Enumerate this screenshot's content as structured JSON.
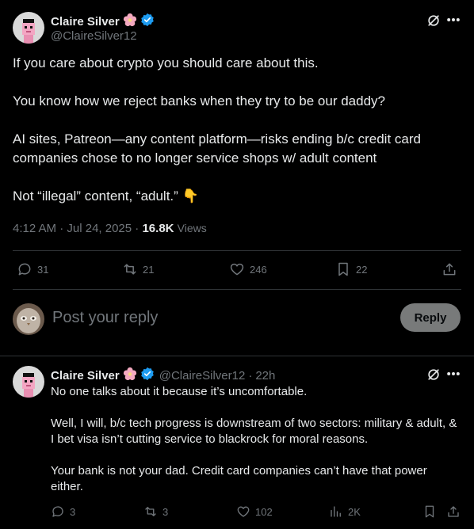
{
  "main_tweet": {
    "author_name": "Claire Silver",
    "author_handle": "@ClaireSilver12",
    "paragraphs": [
      "If you care about crypto you should care about this.",
      "You know how we reject banks when they try to be our daddy?",
      "AI sites, Patreon—any content platform—risks ending b/c credit card companies chose to no longer service shops w/ adult content",
      "Not “illegal” content, “adult.” 👇"
    ],
    "time": "4:12 AM",
    "date": "Jul 24, 2025",
    "views_count": "16.8K",
    "views_label": "Views",
    "stats": {
      "replies": "31",
      "reposts": "21",
      "likes": "246",
      "bookmarks": "22"
    }
  },
  "compose": {
    "placeholder": "Post your reply",
    "reply_button": "Reply"
  },
  "reply_tweet": {
    "author_name": "Claire Silver",
    "author_handle": "@ClaireSilver12",
    "time_ago": "22h",
    "paragraphs": [
      "No one talks about it because it’s uncomfortable.",
      "Well, I will, b/c tech progress is downstream of two sectors: military & adult, & I bet visa isn’t cutting service to blackrock for moral reasons.",
      "Your bank is not your dad. Credit card companies can’t have that power either."
    ],
    "stats": {
      "replies": "3",
      "reposts": "3",
      "likes": "102",
      "views": "2K"
    }
  },
  "colors": {
    "background": "#000000",
    "text": "#e7e9ea",
    "muted": "#71767b",
    "verified": "#1d9bf0",
    "divider": "#2f3336"
  }
}
